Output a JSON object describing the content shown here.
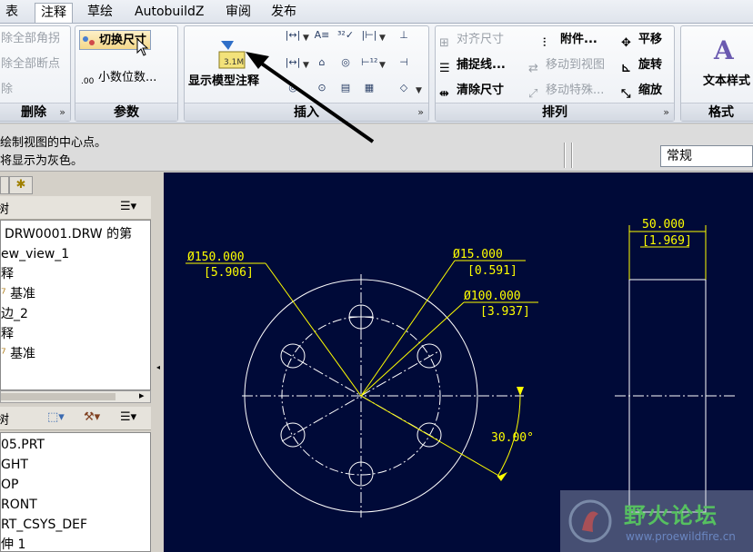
{
  "tabs": [
    "表",
    "注释",
    "草绘",
    "AutobuildZ",
    "审阅",
    "发布"
  ],
  "active_tab": "注释",
  "ribbon": {
    "delete_group": {
      "items": [
        "除全部角拐",
        "除全部断点",
        "除"
      ],
      "title": "删除"
    },
    "params_group": {
      "toggle_dims": "切换尺寸",
      "decimals": "小数位数...",
      "title": "参数"
    },
    "insert_group": {
      "show_model": "显示模型注释",
      "title": "插入"
    },
    "arrange_group": {
      "align": "对齐尺寸",
      "attach": "附件...",
      "move": "平移",
      "snap": "捕捉线...",
      "move_view": "移动到视图",
      "rotate": "旋转",
      "clean": "清除尺寸",
      "move_special": "移动特殊...",
      "scale": "缩放",
      "title": "排列"
    },
    "format_group": {
      "text_style": "文本样式",
      "title": "格式"
    }
  },
  "messages": [
    "绘制视图的中心点。",
    "将显示为灰色。"
  ],
  "filter_value": "常规",
  "tree": {
    "items": [
      "DRW0001.DRW 的第",
      "ew_view_1",
      "释",
      "基准",
      "边_2",
      "释",
      "基准"
    ]
  },
  "model_tree": {
    "items": [
      "05.PRT",
      "GHT",
      "OP",
      "RONT",
      "RT_CSYS_DEF",
      "伸 1"
    ]
  },
  "drawing": {
    "dim_outer_dia": "Ø150.000",
    "dim_outer_dia_in": "[5.906]",
    "dim_hole_dia": "Ø15.000",
    "dim_hole_dia_in": "[0.591]",
    "dim_bolt_circle": "Ø100.000",
    "dim_bolt_circle_in": "[3.937]",
    "dim_angle": "30.00°",
    "dim_thickness": "50.000",
    "dim_thickness_in": "[1.969]"
  },
  "watermark": {
    "title": "野火论坛",
    "url": "www.proewildfire.cn"
  },
  "colors": {
    "canvas": "#000a38",
    "dimension": "#ffff00",
    "geometry": "#ffffff"
  }
}
